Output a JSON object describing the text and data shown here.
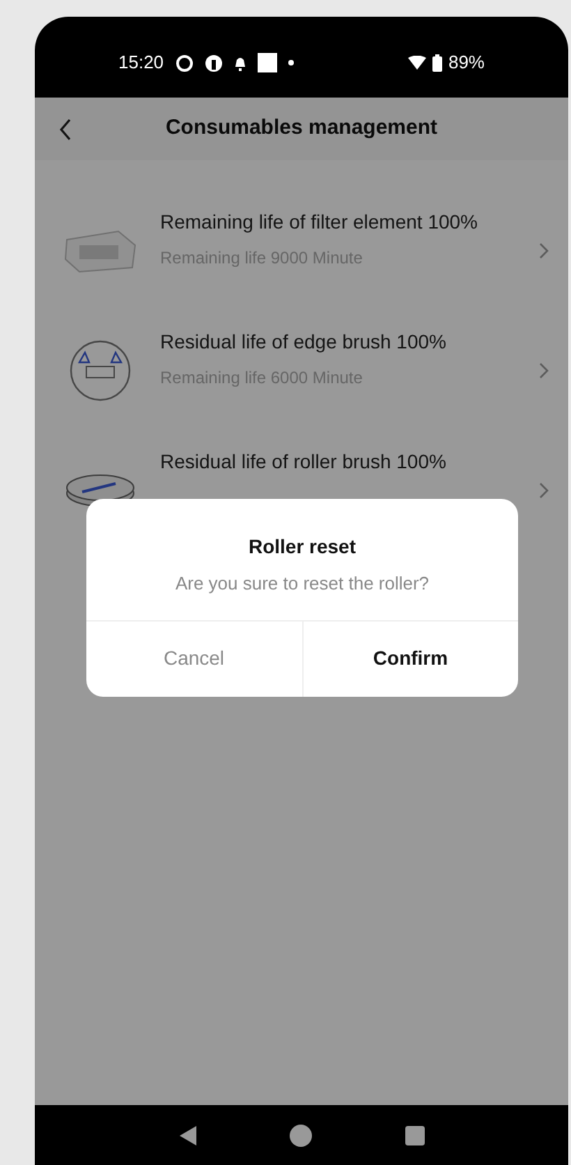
{
  "status_bar": {
    "time": "15:20",
    "battery": "89%"
  },
  "header": {
    "title": "Consumables management"
  },
  "items": [
    {
      "kind": "filter",
      "title": "Remaining life of filter element 100%",
      "subtitle": "Remaining life 9000 Minute"
    },
    {
      "kind": "edge",
      "title": "Residual life of edge brush 100%",
      "subtitle": "Remaining life 6000 Minute"
    },
    {
      "kind": "roller",
      "title": "Residual life of roller brush 100%"
    }
  ],
  "dialog": {
    "title": "Roller reset",
    "message": "Are you sure to reset the roller?",
    "buttons": [
      {
        "label": "Cancel",
        "primary": false
      },
      {
        "label": "Confirm",
        "primary": true
      }
    ]
  }
}
